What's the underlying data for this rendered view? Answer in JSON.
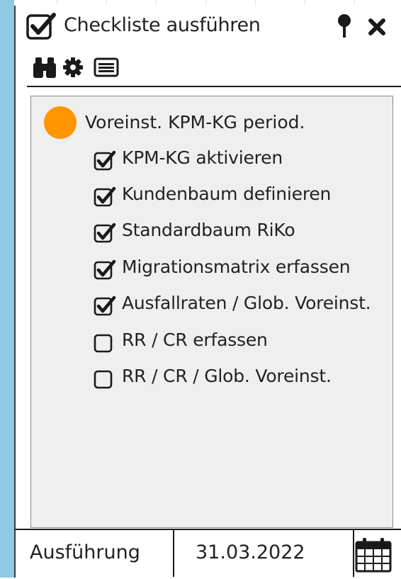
{
  "window": {
    "title": "Checkliste ausführen"
  },
  "toolbar": {
    "icons": [
      "binoculars-icon",
      "gear-icon",
      "list-icon"
    ]
  },
  "checklist": {
    "root": {
      "label": "Voreinst. KPM-KG period.",
      "status_color": "#ff9500"
    },
    "items": [
      {
        "label": "KPM-KG aktivieren",
        "checked": true
      },
      {
        "label": "Kundenbaum definieren",
        "checked": true
      },
      {
        "label": "Standardbaum RiKo",
        "checked": true
      },
      {
        "label": "Migrationsmatrix erfassen",
        "checked": true
      },
      {
        "label": "Ausfallraten / Glob. Voreinst.",
        "checked": true
      },
      {
        "label": "RR / CR erfassen",
        "checked": false
      },
      {
        "label": "RR / CR / Glob. Voreinst.",
        "checked": false
      }
    ]
  },
  "footer": {
    "execution_label": "Ausführung",
    "date_value": "31.03.2022"
  },
  "colors": {
    "accent_strip": "#8ec9e6",
    "status_orange": "#ff9500",
    "tree_background": "#efefef"
  }
}
